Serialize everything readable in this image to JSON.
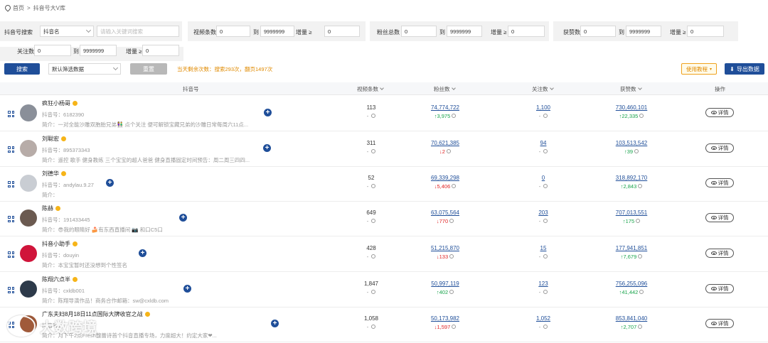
{
  "breadcrumb": {
    "home": "首页",
    "sep": ">",
    "current": "抖音号大V库"
  },
  "filters": {
    "search_label": "抖音号搜索",
    "search_type": "抖音名",
    "search_placeholder": "请输入关键词搜索",
    "video_label": "视频条数",
    "video_min": "0",
    "video_to": "到",
    "video_max": "9999999",
    "video_inc_label": "增量 ≥",
    "video_inc": "0",
    "fans_label": "粉丝总数",
    "fans_min": "0",
    "fans_to": "到",
    "fans_max": "9999999",
    "fans_inc_label": "增量 ≥",
    "fans_inc": "0",
    "likes_label": "获赞数",
    "likes_min": "0",
    "likes_to": "到",
    "likes_max": "9999999",
    "likes_inc_label": "增量 ≥",
    "likes_inc": "0",
    "follow_label": "关注数",
    "follow_min": "0",
    "follow_to": "到",
    "follow_max": "9999999",
    "follow_inc_label": "增量 ≥",
    "follow_inc": "0"
  },
  "toolbar": {
    "search_btn": "搜索",
    "preset_select": "默认筛选数据",
    "reset_btn": "重置",
    "quota_text": "当天剩余次数：搜索293次，翻页1497次",
    "tutorial_btn": "使用教程",
    "export_btn": "导出数据"
  },
  "table": {
    "headers": {
      "account": "抖音号",
      "videos": "视频条数",
      "fans": "粉丝数",
      "follows": "关注数",
      "likes": "获赞数",
      "ops": "操作"
    },
    "id_prefix": "抖音号：",
    "intro_prefix": "简介：",
    "detail_label": "详情",
    "rows": [
      {
        "name": "疯狂小杨哥",
        "dyid": "6182390",
        "intro": "一对全能沙雕双胞胎兄弟👫 点个关注 便可解锁宝藏兄弟的沙雕日常每周六11点...",
        "videos": "113",
        "videos_delta": "- ",
        "fans": "74,774,722",
        "fans_delta": "↑3,975",
        "fans_dir": "up",
        "follows": "1,100",
        "follows_delta": "- ",
        "likes": "730,460,101",
        "likes_delta": "↑22,335",
        "likes_dir": "up"
      },
      {
        "name": "刘聪宏",
        "dyid": "895373343",
        "intro": "遥控 歌手 健身教练 三个宝宝的超人爸爸 健身直播固定时间预告：周二周三四四...",
        "videos": "311",
        "videos_delta": "- ",
        "fans": "70,621,385",
        "fans_delta": "↓2",
        "fans_dir": "down",
        "follows": "94",
        "follows_delta": "- ",
        "likes": "103,513,542",
        "likes_delta": "↑39",
        "likes_dir": "up"
      },
      {
        "name": "刘德华",
        "dyid": "andylau.9.27",
        "intro": "",
        "videos": "52",
        "videos_delta": "- ",
        "fans": "69,339,298",
        "fans_delta": "↓5,406",
        "fans_dir": "down",
        "follows": "0",
        "follows_delta": "- ",
        "likes": "318,892,170",
        "likes_delta": "↑2,843",
        "likes_dir": "up"
      },
      {
        "name": "陈赫",
        "dyid": "191433445",
        "intro": "😎我的眼睛好 🍰有东西直播间 📷 和口C5口",
        "videos": "649",
        "videos_delta": "- ",
        "fans": "63,075,564",
        "fans_delta": "↓770",
        "fans_dir": "down",
        "follows": "203",
        "follows_delta": "- ",
        "likes": "707,013,551",
        "likes_delta": "↑175",
        "likes_dir": "up"
      },
      {
        "name": "抖音小助手",
        "dyid": "douyin",
        "intro": "本宝宝暂时还没想到个性签名",
        "videos": "428",
        "videos_delta": "- ",
        "fans": "51,215,870",
        "fans_delta": "↓133",
        "fans_dir": "down",
        "follows": "15",
        "follows_delta": "- ",
        "likes": "177,941,851",
        "likes_delta": "↑7,679",
        "likes_dir": "up"
      },
      {
        "name": "陈翔六点半",
        "dyid": "cxldb001",
        "intro": "陈翔导演作品！商务合作邮箱：sw@cxldb.com",
        "videos": "1,847",
        "videos_delta": "- ",
        "fans": "50,997,119",
        "fans_delta": "↑402",
        "fans_dir": "up",
        "follows": "123",
        "follows_delta": "- ",
        "likes": "756,255,096",
        "likes_delta": "↑41,442",
        "likes_dir": "up"
      },
      {
        "name": "广东夫妇8月18日11点国际大牌收官之战",
        "dyid": "",
        "intro": "月下午2点Fresh馥蕾诗首个抖音直播专场，力度超大！约定大家❤...",
        "videos": "1,058",
        "videos_delta": "- ",
        "fans": "50,173,982",
        "fans_delta": "↓1,597",
        "fans_dir": "down",
        "follows": "1,052",
        "follows_delta": "- ",
        "likes": "853,841,040",
        "likes_delta": "↑2,707",
        "likes_dir": "up"
      }
    ]
  },
  "watermark": "大数跨境",
  "colors": {
    "primary": "#1f4e99",
    "up": "#17a34a",
    "down": "#e02424",
    "orange": "#e08a00"
  }
}
